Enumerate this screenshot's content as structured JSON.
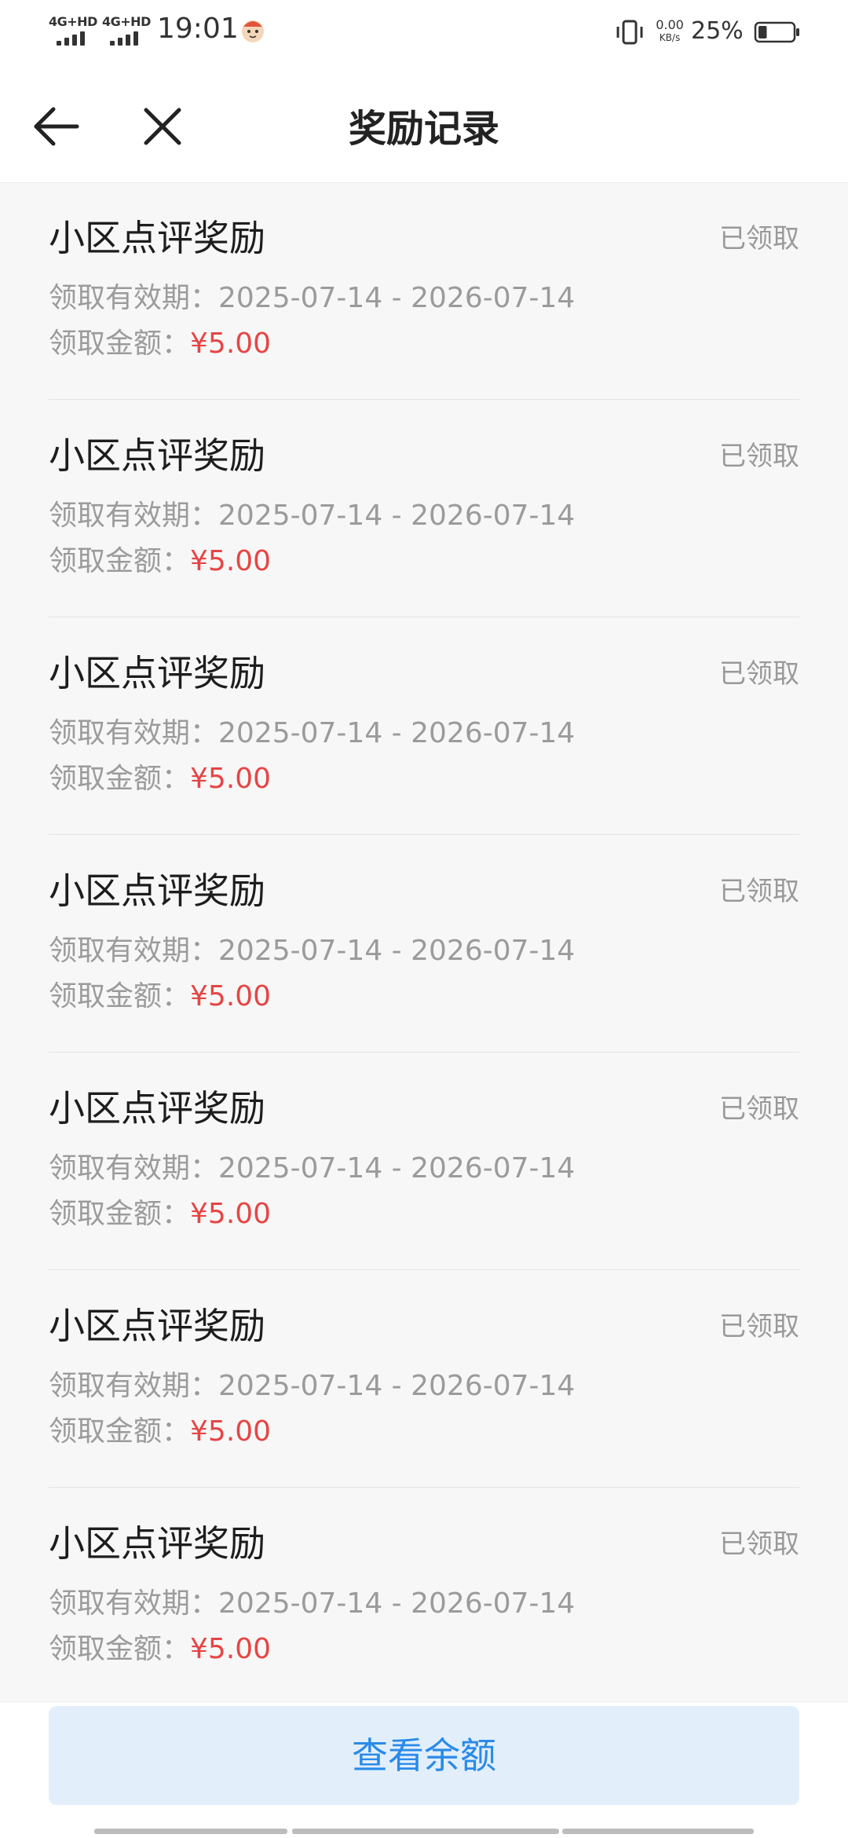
{
  "status_bar": {
    "signal1": "4G+HD",
    "signal2": "4G+HD",
    "time": "19:01",
    "net_speed_value": "0.00",
    "net_speed_unit": "KB/s",
    "battery_percent": "25%",
    "battery_level": 0.25,
    "icons": [
      "signal-icon",
      "mascot-icon",
      "vibrate-icon",
      "battery-icon"
    ]
  },
  "header": {
    "title": "奖励记录",
    "back_icon": "arrow-left-icon",
    "close_icon": "close-icon"
  },
  "records": [
    {
      "title": "小区点评奖励",
      "status": "已领取",
      "validity_label": "领取有效期：",
      "validity": "2025-07-14 - 2026-07-14",
      "amount_label": "领取金额：",
      "amount": "¥5.00"
    },
    {
      "title": "小区点评奖励",
      "status": "已领取",
      "validity_label": "领取有效期：",
      "validity": "2025-07-14 - 2026-07-14",
      "amount_label": "领取金额：",
      "amount": "¥5.00"
    },
    {
      "title": "小区点评奖励",
      "status": "已领取",
      "validity_label": "领取有效期：",
      "validity": "2025-07-14 - 2026-07-14",
      "amount_label": "领取金额：",
      "amount": "¥5.00"
    },
    {
      "title": "小区点评奖励",
      "status": "已领取",
      "validity_label": "领取有效期：",
      "validity": "2025-07-14 - 2026-07-14",
      "amount_label": "领取金额：",
      "amount": "¥5.00"
    },
    {
      "title": "小区点评奖励",
      "status": "已领取",
      "validity_label": "领取有效期：",
      "validity": "2025-07-14 - 2026-07-14",
      "amount_label": "领取金额：",
      "amount": "¥5.00"
    },
    {
      "title": "小区点评奖励",
      "status": "已领取",
      "validity_label": "领取有效期：",
      "validity": "2025-07-14 - 2026-07-14",
      "amount_label": "领取金额：",
      "amount": "¥5.00"
    },
    {
      "title": "小区点评奖励",
      "status": "已领取",
      "validity_label": "领取有效期：",
      "validity": "2025-07-14 - 2026-07-14",
      "amount_label": "领取金额：",
      "amount": "¥5.00"
    }
  ],
  "bottom": {
    "balance_button": "查看余额"
  },
  "colors": {
    "amount": "#e64545",
    "button_text": "#2a8ae8",
    "button_bg": "#e2effb",
    "muted_text": "#9b9b9b"
  }
}
